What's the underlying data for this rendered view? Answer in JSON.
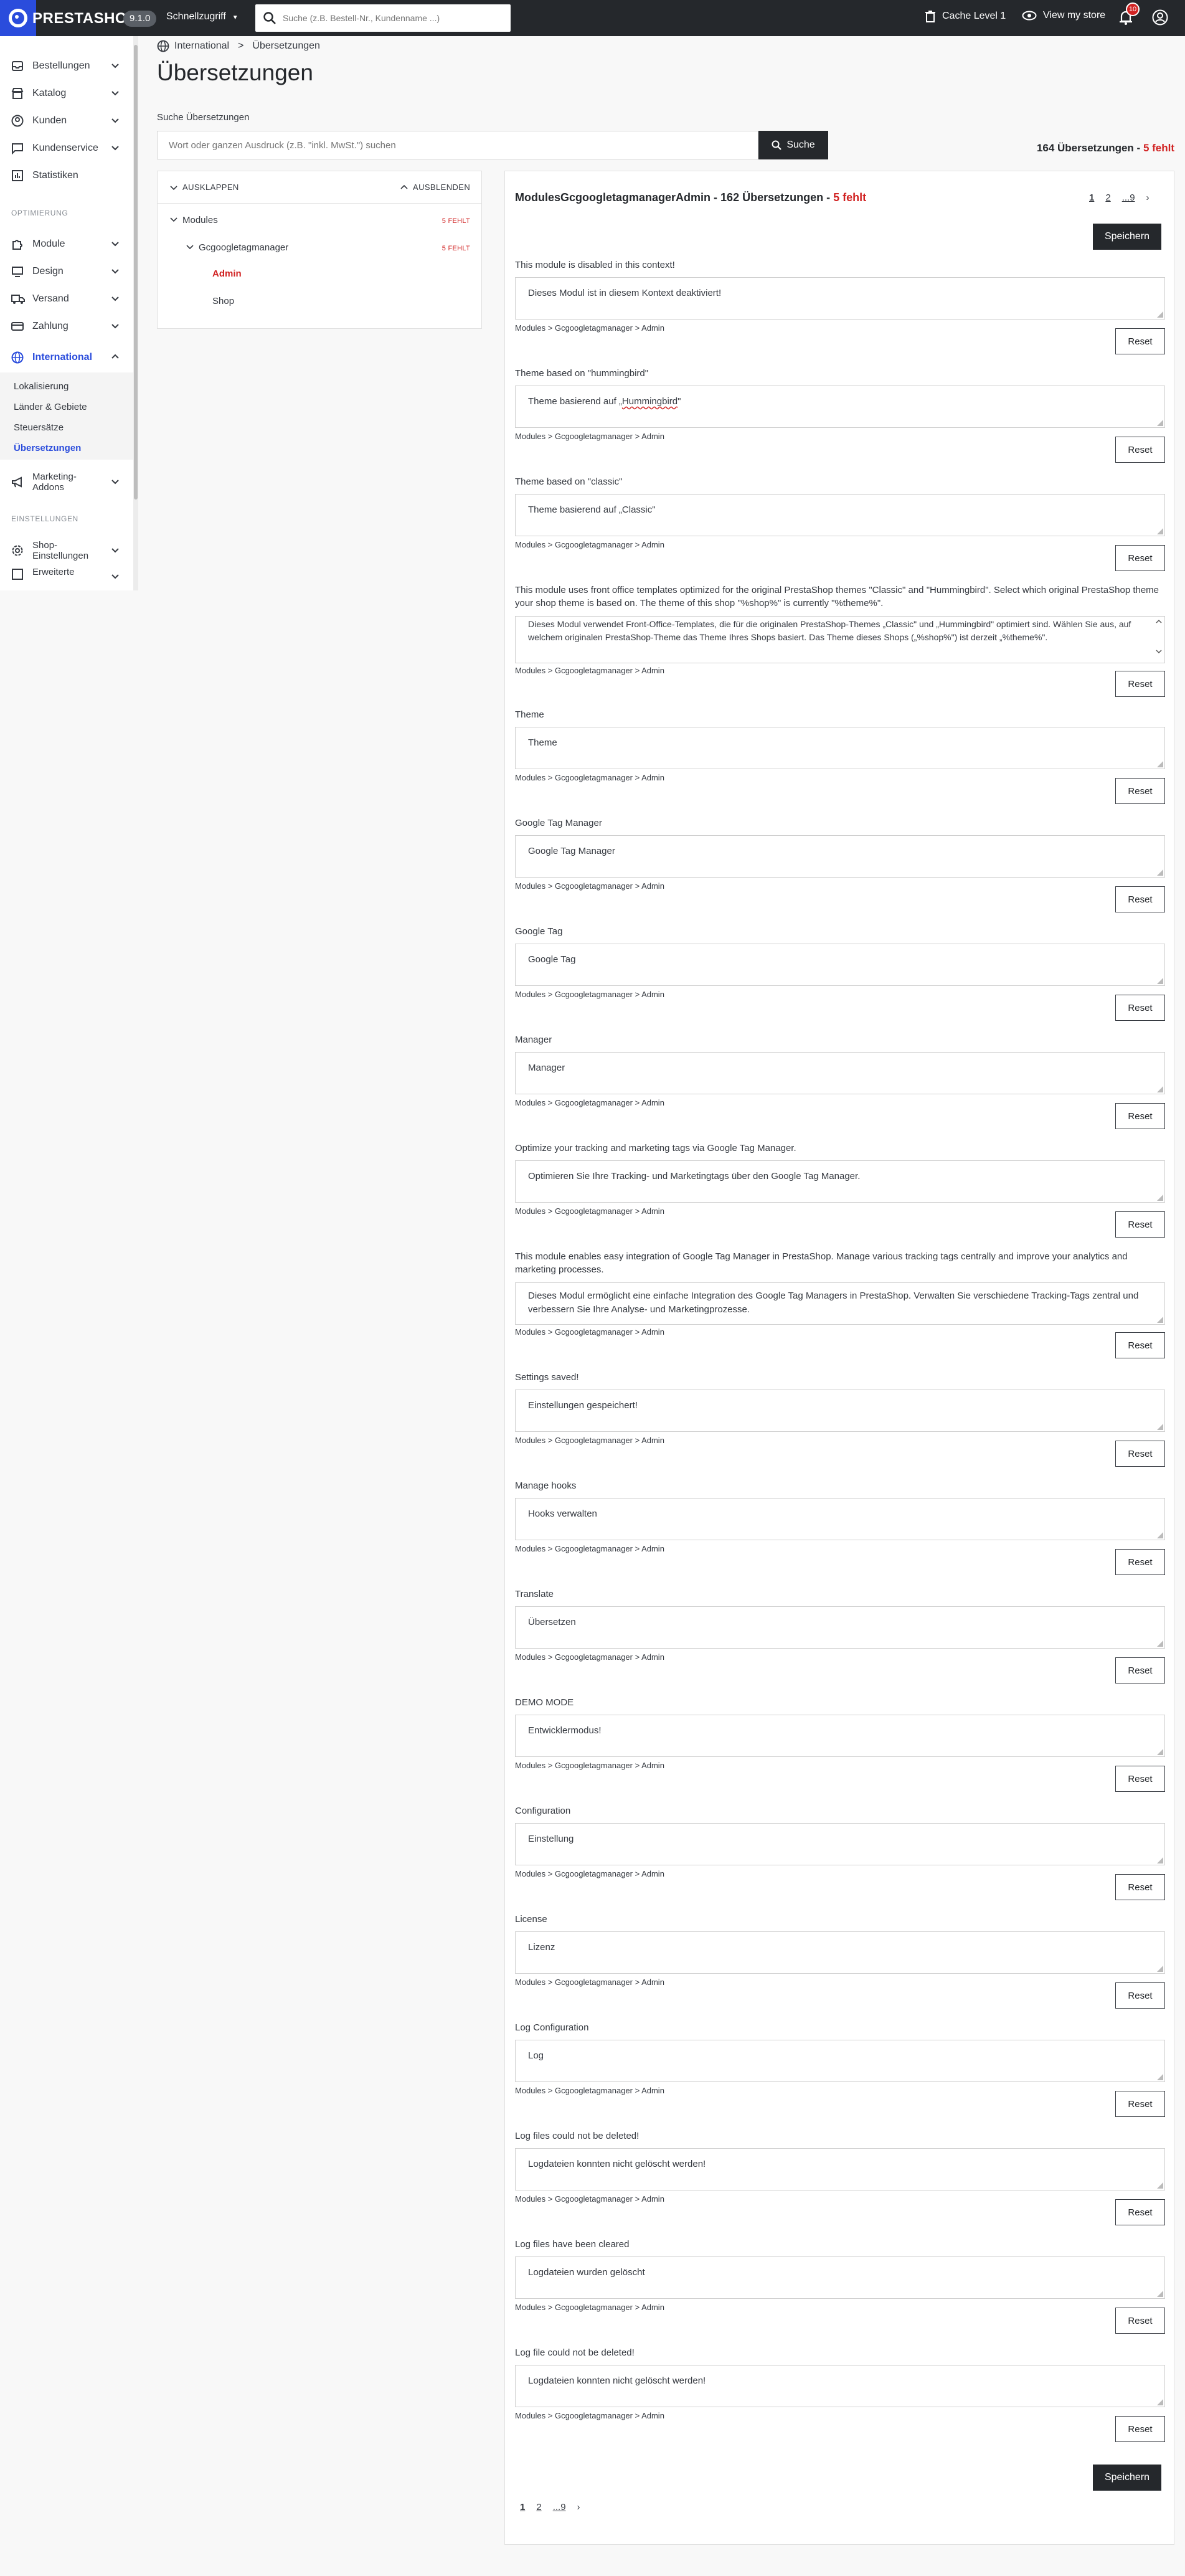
{
  "topbar": {
    "logo_text": "PRESTASHOP",
    "version": "9.1.0",
    "quick_access": "Schnellzugriff",
    "search_placeholder": "Suche (z.B. Bestell-Nr., Kundenname ...)",
    "cache": "Cache Level 1",
    "view_store": "View my store",
    "notifications_count": "10"
  },
  "sidebar": {
    "items": [
      {
        "label": "Bestellungen",
        "icon": "inbox-icon"
      },
      {
        "label": "Katalog",
        "icon": "store-icon"
      },
      {
        "label": "Kunden",
        "icon": "account-circle-icon"
      },
      {
        "label": "Kundenservice",
        "icon": "chat-icon"
      },
      {
        "label": "Statistiken",
        "icon": "bar-chart-icon"
      }
    ],
    "section_optimize": "OPTIMIERUNG",
    "items2": [
      {
        "label": "Module",
        "icon": "puzzle-icon"
      },
      {
        "label": "Design",
        "icon": "monitor-icon"
      },
      {
        "label": "Versand",
        "icon": "truck-icon"
      },
      {
        "label": "Zahlung",
        "icon": "card-icon"
      },
      {
        "label": "International",
        "icon": "globe-icon"
      }
    ],
    "subitems": [
      "Lokalisierung",
      "Länder & Gebiete",
      "Steuersätze",
      "Übersetzungen"
    ],
    "marketing": "Marketing-Addons",
    "section_settings": "EINSTELLUNGEN",
    "shop_settings": "Shop-Einstellungen",
    "advanced": "Erweiterte"
  },
  "breadcrumb": {
    "parent": "International",
    "sep": ">",
    "current": "Übersetzungen"
  },
  "page_title": "Übersetzungen",
  "search": {
    "label": "Suche Übersetzungen",
    "placeholder": "Wort oder ganzen Ausdruck (z.B. \"inkl. MwSt.\") suchen",
    "button": "Suche"
  },
  "totals": {
    "count": "164 Übersetzungen",
    "missing": "5 fehlt"
  },
  "tree": {
    "expand": "AUSKLAPPEN",
    "collapse": "AUSBLENDEN",
    "modules": "Modules",
    "modules_missing": "5 FEHLT",
    "module": "Gcgoogletagmanager",
    "module_missing": "5 FEHLT",
    "admin": "Admin",
    "shop": "Shop"
  },
  "panel": {
    "title": "ModulesGcgoogletagmanagerAdmin",
    "count": "162 Übersetzungen",
    "missing": "5 fehlt",
    "save": "Speichern",
    "pages": [
      "1",
      "2",
      "...9",
      "›"
    ]
  },
  "crumb": "Modules > Gcgoogletagmanager > Admin",
  "reset": "Reset",
  "translations": [
    {
      "source": "This module is disabled in this context!",
      "target": "Dieses Modul ist in diesem Kontext deaktiviert!"
    },
    {
      "source": "Theme based on \"hummingbird\"",
      "target_a": "Theme basierend auf „",
      "target_b": "Hummingbird",
      "target_c": "\""
    },
    {
      "source": "Theme based on \"classic\"",
      "target": "Theme basierend auf „Classic\""
    },
    {
      "source": "This module uses front office templates optimized for the original PrestaShop themes \"Classic\" and \"Hummingbird\". Select which original PrestaShop theme your shop theme is based on. The theme of this shop \"%shop%\" is currently \"%theme%\".",
      "target": "Dieses Modul verwendet Front-Office-Templates, die für die originalen PrestaShop-Themes „Classic\" und „Hummingbird\" optimiert sind. Wählen Sie aus, auf welchem originalen PrestaShop-Theme das Theme Ihres Shops basiert. Das Theme dieses Shops („%shop%\") ist derzeit „%theme%\"."
    },
    {
      "source": "Theme",
      "target": "Theme"
    },
    {
      "source": "Google Tag Manager",
      "target": "Google Tag Manager"
    },
    {
      "source": "Google Tag",
      "target": "Google Tag"
    },
    {
      "source": "Manager",
      "target": "Manager"
    },
    {
      "source": "Optimize your tracking and marketing tags via Google Tag Manager.",
      "target": "Optimieren Sie Ihre Tracking- und Marketingtags über den Google Tag Manager."
    },
    {
      "source": "This module enables easy integration of Google Tag Manager in PrestaShop. Manage various tracking tags centrally and improve your analytics and marketing processes.",
      "target": "Dieses Modul ermöglicht eine einfache Integration des Google Tag Managers in PrestaShop. Verwalten Sie verschiedene Tracking-Tags zentral und verbessern Sie Ihre Analyse- und Marketingprozesse."
    },
    {
      "source": "Settings saved!",
      "target": "Einstellungen gespeichert!"
    },
    {
      "source": "Manage hooks",
      "target": "Hooks verwalten"
    },
    {
      "source": "Translate",
      "target": "Übersetzen"
    },
    {
      "source": "DEMO MODE",
      "target": "Entwicklermodus!"
    },
    {
      "source": "Configuration",
      "target": "Einstellung"
    },
    {
      "source": "License",
      "target": "Lizenz"
    },
    {
      "source": "Log Configuration",
      "target": "Log"
    },
    {
      "source": "Log files could not be deleted!",
      "target": "Logdateien konnten nicht gelöscht werden!"
    },
    {
      "source": "Log files have been cleared",
      "target": "Logdateien wurden gelöscht"
    },
    {
      "source": "Log file could not be deleted!",
      "target": "Logdateien konnten nicht gelöscht werden!"
    }
  ],
  "colors": {
    "accent": "#2a4cdc",
    "missing": "#d12323",
    "dark": "#25282c"
  }
}
